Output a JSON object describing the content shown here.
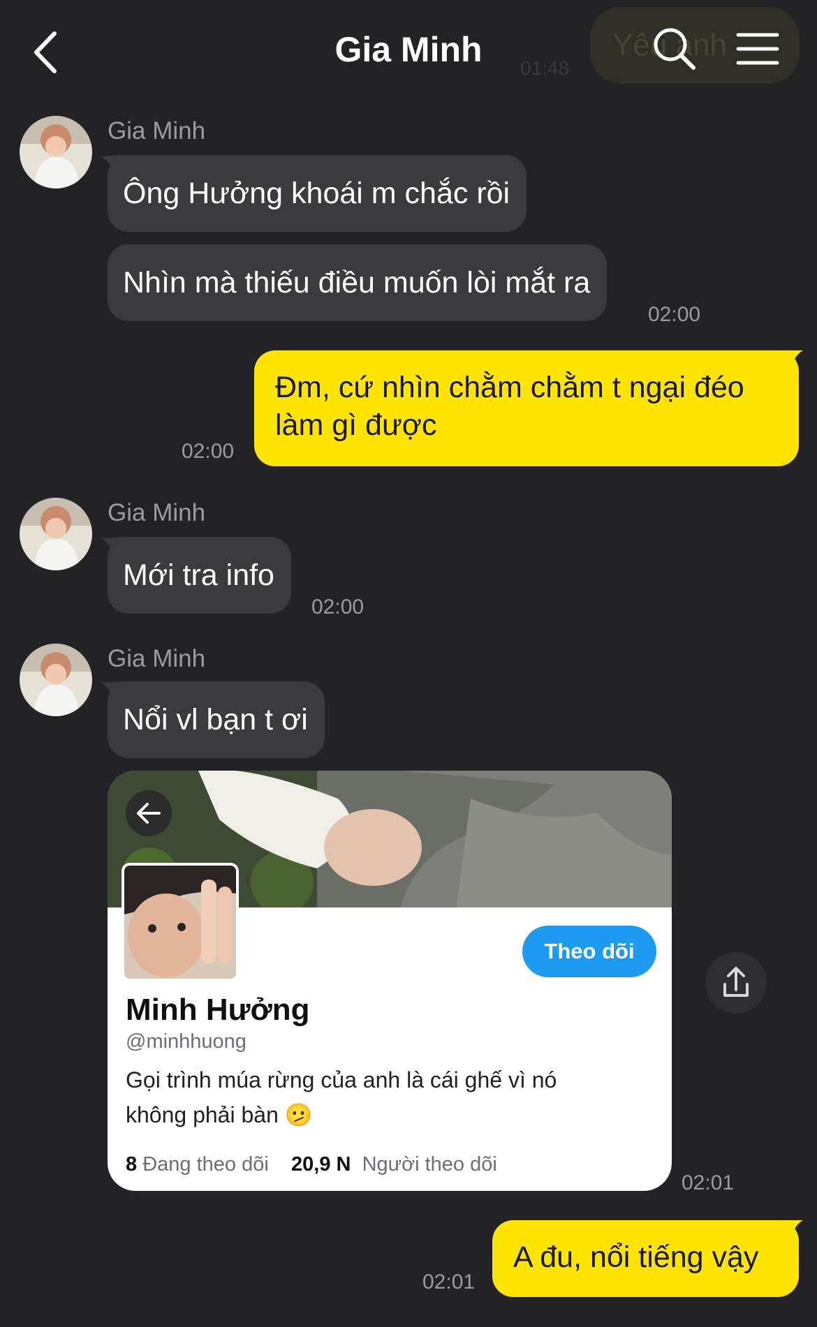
{
  "header": {
    "title": "Gia Minh",
    "ghost_time": "01:48",
    "ghost_text": "Yêu anh",
    "back_icon": "chevron-left-icon",
    "search_icon": "search-icon",
    "menu_icon": "menu-icon"
  },
  "messages": [
    {
      "sender": "Gia Minh",
      "text": "Ông Hưởng khoái m chắc rồi"
    },
    {
      "text": "Nhìn mà thiếu điều muốn lòi mắt ra",
      "time": "02:00"
    },
    {
      "outgoing": true,
      "line1": "Đm, cứ nhìn chằm chằm t ngại đéo",
      "line2": "làm gì được",
      "time": "02:00"
    },
    {
      "sender": "Gia Minh",
      "text": "Mới tra info",
      "time": "02:00"
    },
    {
      "sender": "Gia Minh",
      "text": "Nổi vl bạn t ơi"
    },
    {
      "outgoing": true,
      "text": "A đu, nổi tiếng vậy",
      "time": "02:01"
    }
  ],
  "card": {
    "follow_label": "Theo dõi",
    "name": "Minh Hưởng",
    "handle": "@minhhuong",
    "bio_line1": "Gọi trình múa rừng của anh là cái ghế vì nó",
    "bio_line2": "không phải bàn 🫤",
    "following_count": "8",
    "following_label": "Đang theo dõi",
    "followers_count": "20,9 N",
    "followers_label": "Người theo dõi",
    "time": "02:01"
  },
  "colors": {
    "background": "#232325",
    "incoming_bubble": "#3b3b3e",
    "outgoing_bubble": "#fee500",
    "follow_button": "#1d9bf0"
  }
}
